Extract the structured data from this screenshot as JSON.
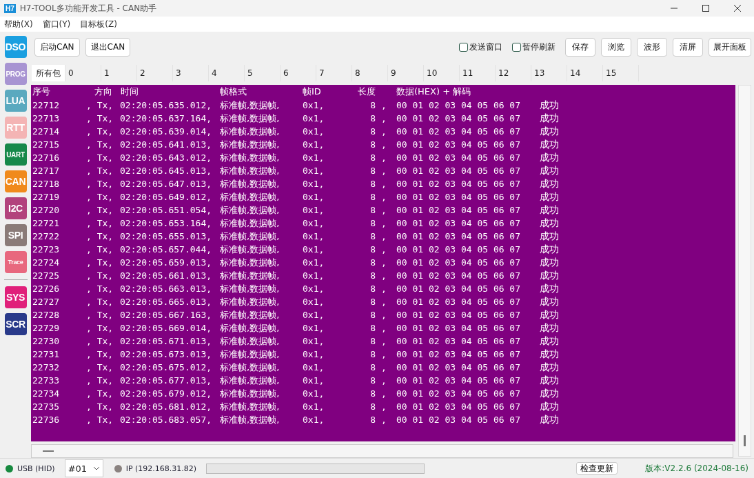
{
  "window": {
    "logo": "H7",
    "title": "H7-TOOL多功能开发工具 - CAN助手"
  },
  "menu": [
    "帮助(X)",
    "窗口(Y)",
    "目标板(Z)"
  ],
  "sidebar": [
    {
      "label": "DSO",
      "color": "#1a9fe0"
    },
    {
      "label": "PROG",
      "color": "#a894d2"
    },
    {
      "label": "LUA",
      "color": "#5aa9bf"
    },
    {
      "label": "RTT",
      "color": "#f4b4b4"
    },
    {
      "label": "UART",
      "color": "#17894a"
    },
    {
      "label": "CAN",
      "color": "#f08a1c"
    },
    {
      "label": "I2C",
      "color": "#b2427c"
    },
    {
      "label": "SPI",
      "color": "#8a7b78"
    },
    {
      "label": "Trace",
      "color": "#e8687e"
    },
    {
      "label": "SYS",
      "color": "#e0207a"
    },
    {
      "label": "SCR",
      "color": "#293a8a"
    }
  ],
  "toolbar": {
    "left_buttons": [
      "启动CAN",
      "退出CAN"
    ],
    "checkboxes": [
      {
        "label": "发送窗口",
        "checked": false
      },
      {
        "label": "暂停刷新",
        "checked": false
      }
    ],
    "right_buttons": [
      "保存",
      "浏览",
      "波形",
      "清屏",
      "展开面板"
    ]
  },
  "tabs": [
    {
      "label": "所有包",
      "selected": true
    },
    {
      "label": "0",
      "selected": false
    },
    {
      "label": "1",
      "selected": false
    },
    {
      "label": "2",
      "selected": false
    },
    {
      "label": "3",
      "selected": false
    },
    {
      "label": "4",
      "selected": false
    },
    {
      "label": "5",
      "selected": false
    },
    {
      "label": "6",
      "selected": false
    },
    {
      "label": "7",
      "selected": false
    },
    {
      "label": "8",
      "selected": false
    },
    {
      "label": "9",
      "selected": false
    },
    {
      "label": "10",
      "selected": false
    },
    {
      "label": "11",
      "selected": false
    },
    {
      "label": "12",
      "selected": false
    },
    {
      "label": "13",
      "selected": false
    },
    {
      "label": "14",
      "selected": false
    },
    {
      "label": "15",
      "selected": false
    }
  ],
  "log": {
    "header": [
      "序号",
      "方向",
      "时间",
      "帧格式",
      "帧ID",
      "长度",
      "数据(HEX) + 解码"
    ],
    "rows": [
      {
        "seq": "22712",
        "dir": ", Tx,",
        "time": "02:20:05.635.012,",
        "format": "标准帧,数据帧,",
        "id": "0x1,",
        "len": "8",
        "sep": ",",
        "data": "00 01 02 03 04 05 06 07",
        "decode": "成功"
      },
      {
        "seq": "22713",
        "dir": ", Tx,",
        "time": "02:20:05.637.164,",
        "format": "标准帧,数据帧,",
        "id": "0x1,",
        "len": "8",
        "sep": ",",
        "data": "00 01 02 03 04 05 06 07",
        "decode": "成功"
      },
      {
        "seq": "22714",
        "dir": ", Tx,",
        "time": "02:20:05.639.014,",
        "format": "标准帧,数据帧,",
        "id": "0x1,",
        "len": "8",
        "sep": ",",
        "data": "00 01 02 03 04 05 06 07",
        "decode": "成功"
      },
      {
        "seq": "22715",
        "dir": ", Tx,",
        "time": "02:20:05.641.013,",
        "format": "标准帧,数据帧,",
        "id": "0x1,",
        "len": "8",
        "sep": ",",
        "data": "00 01 02 03 04 05 06 07",
        "decode": "成功"
      },
      {
        "seq": "22716",
        "dir": ", Tx,",
        "time": "02:20:05.643.012,",
        "format": "标准帧,数据帧,",
        "id": "0x1,",
        "len": "8",
        "sep": ",",
        "data": "00 01 02 03 04 05 06 07",
        "decode": "成功"
      },
      {
        "seq": "22717",
        "dir": ", Tx,",
        "time": "02:20:05.645.013,",
        "format": "标准帧,数据帧,",
        "id": "0x1,",
        "len": "8",
        "sep": ",",
        "data": "00 01 02 03 04 05 06 07",
        "decode": "成功"
      },
      {
        "seq": "22718",
        "dir": ", Tx,",
        "time": "02:20:05.647.013,",
        "format": "标准帧,数据帧,",
        "id": "0x1,",
        "len": "8",
        "sep": ",",
        "data": "00 01 02 03 04 05 06 07",
        "decode": "成功"
      },
      {
        "seq": "22719",
        "dir": ", Tx,",
        "time": "02:20:05.649.012,",
        "format": "标准帧,数据帧,",
        "id": "0x1,",
        "len": "8",
        "sep": ",",
        "data": "00 01 02 03 04 05 06 07",
        "decode": "成功"
      },
      {
        "seq": "22720",
        "dir": ", Tx,",
        "time": "02:20:05.651.054,",
        "format": "标准帧,数据帧,",
        "id": "0x1,",
        "len": "8",
        "sep": ",",
        "data": "00 01 02 03 04 05 06 07",
        "decode": "成功"
      },
      {
        "seq": "22721",
        "dir": ", Tx,",
        "time": "02:20:05.653.164,",
        "format": "标准帧,数据帧,",
        "id": "0x1,",
        "len": "8",
        "sep": ",",
        "data": "00 01 02 03 04 05 06 07",
        "decode": "成功"
      },
      {
        "seq": "22722",
        "dir": ", Tx,",
        "time": "02:20:05.655.013,",
        "format": "标准帧,数据帧,",
        "id": "0x1,",
        "len": "8",
        "sep": ",",
        "data": "00 01 02 03 04 05 06 07",
        "decode": "成功"
      },
      {
        "seq": "22723",
        "dir": ", Tx,",
        "time": "02:20:05.657.044,",
        "format": "标准帧,数据帧,",
        "id": "0x1,",
        "len": "8",
        "sep": ",",
        "data": "00 01 02 03 04 05 06 07",
        "decode": "成功"
      },
      {
        "seq": "22724",
        "dir": ", Tx,",
        "time": "02:20:05.659.013,",
        "format": "标准帧,数据帧,",
        "id": "0x1,",
        "len": "8",
        "sep": ",",
        "data": "00 01 02 03 04 05 06 07",
        "decode": "成功"
      },
      {
        "seq": "22725",
        "dir": ", Tx,",
        "time": "02:20:05.661.013,",
        "format": "标准帧,数据帧,",
        "id": "0x1,",
        "len": "8",
        "sep": ",",
        "data": "00 01 02 03 04 05 06 07",
        "decode": "成功"
      },
      {
        "seq": "22726",
        "dir": ", Tx,",
        "time": "02:20:05.663.013,",
        "format": "标准帧,数据帧,",
        "id": "0x1,",
        "len": "8",
        "sep": ",",
        "data": "00 01 02 03 04 05 06 07",
        "decode": "成功"
      },
      {
        "seq": "22727",
        "dir": ", Tx,",
        "time": "02:20:05.665.013,",
        "format": "标准帧,数据帧,",
        "id": "0x1,",
        "len": "8",
        "sep": ",",
        "data": "00 01 02 03 04 05 06 07",
        "decode": "成功"
      },
      {
        "seq": "22728",
        "dir": ", Tx,",
        "time": "02:20:05.667.163,",
        "format": "标准帧,数据帧,",
        "id": "0x1,",
        "len": "8",
        "sep": ",",
        "data": "00 01 02 03 04 05 06 07",
        "decode": "成功"
      },
      {
        "seq": "22729",
        "dir": ", Tx,",
        "time": "02:20:05.669.014,",
        "format": "标准帧,数据帧,",
        "id": "0x1,",
        "len": "8",
        "sep": ",",
        "data": "00 01 02 03 04 05 06 07",
        "decode": "成功"
      },
      {
        "seq": "22730",
        "dir": ", Tx,",
        "time": "02:20:05.671.013,",
        "format": "标准帧,数据帧,",
        "id": "0x1,",
        "len": "8",
        "sep": ",",
        "data": "00 01 02 03 04 05 06 07",
        "decode": "成功"
      },
      {
        "seq": "22731",
        "dir": ", Tx,",
        "time": "02:20:05.673.013,",
        "format": "标准帧,数据帧,",
        "id": "0x1,",
        "len": "8",
        "sep": ",",
        "data": "00 01 02 03 04 05 06 07",
        "decode": "成功"
      },
      {
        "seq": "22732",
        "dir": ", Tx,",
        "time": "02:20:05.675.012,",
        "format": "标准帧,数据帧,",
        "id": "0x1,",
        "len": "8",
        "sep": ",",
        "data": "00 01 02 03 04 05 06 07",
        "decode": "成功"
      },
      {
        "seq": "22733",
        "dir": ", Tx,",
        "time": "02:20:05.677.013,",
        "format": "标准帧,数据帧,",
        "id": "0x1,",
        "len": "8",
        "sep": ",",
        "data": "00 01 02 03 04 05 06 07",
        "decode": "成功"
      },
      {
        "seq": "22734",
        "dir": ", Tx,",
        "time": "02:20:05.679.012,",
        "format": "标准帧,数据帧,",
        "id": "0x1,",
        "len": "8",
        "sep": ",",
        "data": "00 01 02 03 04 05 06 07",
        "decode": "成功"
      },
      {
        "seq": "22735",
        "dir": ", Tx,",
        "time": "02:20:05.681.012,",
        "format": "标准帧,数据帧,",
        "id": "0x1,",
        "len": "8",
        "sep": ",",
        "data": "00 01 02 03 04 05 06 07",
        "decode": "成功"
      },
      {
        "seq": "22736",
        "dir": ", Tx,",
        "time": "02:20:05.683.057,",
        "format": "标准帧,数据帧,",
        "id": "0x1,",
        "len": "8",
        "sep": ",",
        "data": "00 01 02 03 04 05 06 07",
        "decode": "成功"
      }
    ]
  },
  "status_bar": {
    "usb": {
      "label": "USB (HID)",
      "color": "#17893f"
    },
    "device": "#01",
    "ip": {
      "label": "IP (192.168.31.82)",
      "color": "#8a8280"
    },
    "progress": {
      "level": 0
    },
    "update_button": "检查更新",
    "version": "版本:V2.2.6 (2024-08-16)"
  }
}
